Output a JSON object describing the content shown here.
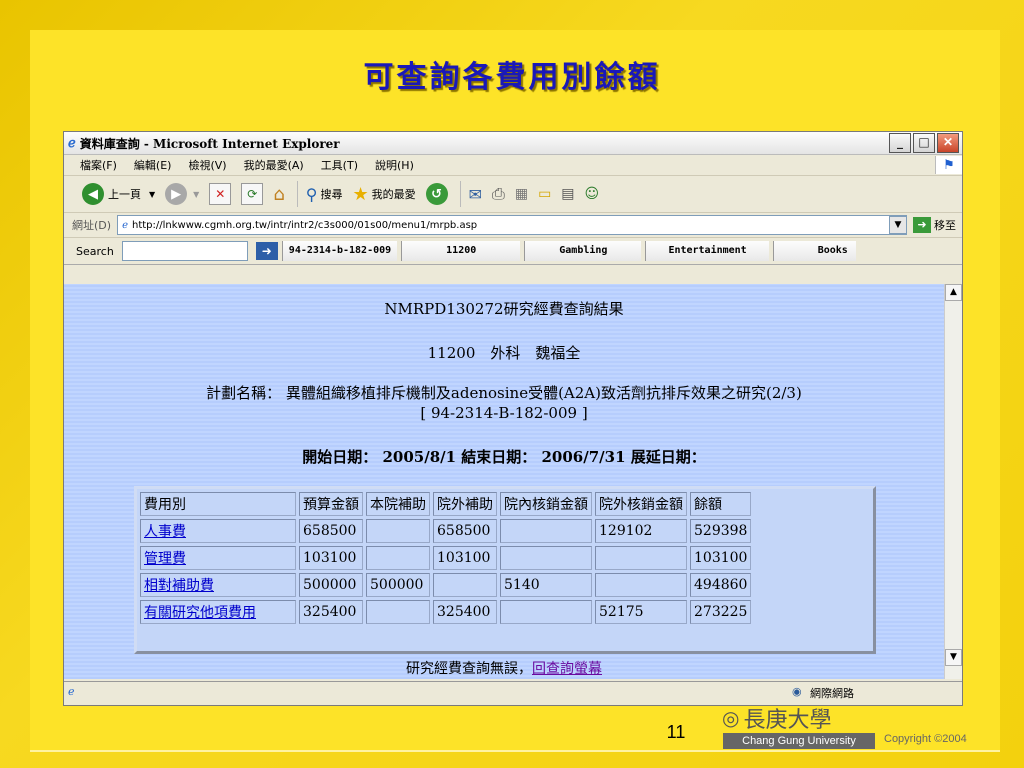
{
  "slide": {
    "title": "可查詢各費用別餘額",
    "page_number": "11",
    "logo_text": "長庚大學",
    "university": "Chang Gung University",
    "copyright": "Copyright ©2004"
  },
  "window": {
    "title": "資料庫查詢 - Microsoft Internet Explorer",
    "min": "_",
    "max": "□",
    "close": "✕"
  },
  "menu": [
    "檔案(F)",
    "編輯(E)",
    "檢視(V)",
    "我的最愛(A)",
    "工具(T)",
    "說明(H)"
  ],
  "toolbar": {
    "back_label": "上一頁",
    "search_label": "搜尋",
    "favorites_label": "我的最愛"
  },
  "address": {
    "label": "網址(D)",
    "url": "http://lnkwww.cgmh.org.tw/intr/intr2/c3s000/01s00/menu1/mrpb.asp",
    "go_label": "移至"
  },
  "searchbar": {
    "label": "Search",
    "tabs": [
      "94-2314-b-182-009",
      "11200",
      "Gambling",
      "Entertainment",
      "Books"
    ]
  },
  "page": {
    "heading": "NMRPD130272研究經費查詢結果",
    "dept_line": "11200　外科　魏福全",
    "plan_line": "計劃名稱： 異體組織移植排斥機制及adenosine受體(A2A)致活劑抗排斥效果之研究(2/3)",
    "plan_code": "[ 94-2314-B-182-009 ]",
    "dates_line": "開始日期： 2005/8/1 結束日期： 2006/7/31 展延日期：",
    "footer_text": "研究經費查詢無誤，",
    "footer_link": "回查詢螢幕"
  },
  "table": {
    "headers": [
      "費用別",
      "預算金額",
      "本院補助",
      "院外補助",
      "院內核銷金額",
      "院外核銷金額",
      "餘額"
    ],
    "rows": [
      [
        "人事費",
        "658500",
        "",
        "658500",
        "",
        "129102",
        "529398"
      ],
      [
        "管理費",
        "103100",
        "",
        "103100",
        "",
        "",
        "103100"
      ],
      [
        "相對補助費",
        "500000",
        "500000",
        "",
        "5140",
        "",
        "494860"
      ],
      [
        "有關研究他項費用",
        "325400",
        "",
        "325400",
        "",
        "52175",
        "273225"
      ]
    ]
  },
  "status": {
    "zone": "網際網路"
  }
}
